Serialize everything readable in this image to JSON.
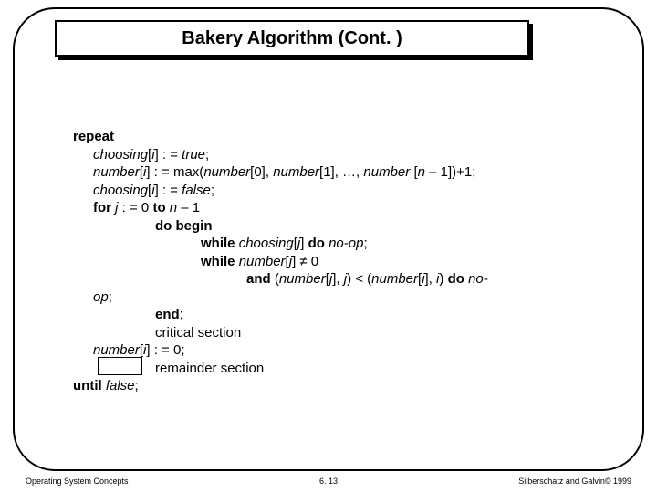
{
  "title": "Bakery Algorithm (Cont. )",
  "code": {
    "l1a": "repeat",
    "l2a": "choosing",
    "l2b": "[",
    "l2c": "i",
    "l2d": "] : = ",
    "l2e": "true",
    "l2f": ";",
    "l3a": "number",
    "l3b": "[",
    "l3c": "i",
    "l3d": "] : = max(",
    "l3e": "number",
    "l3f": "[0], ",
    "l3g": "number",
    "l3h": "[1], …, ",
    "l3i": "number ",
    "l3j": "[",
    "l3k": "n",
    "l3l": " – 1])+1;",
    "l4a": "choosing",
    "l4b": "[",
    "l4c": "i",
    "l4d": "] : = ",
    "l4e": "false",
    "l4f": ";",
    "l5a": "for ",
    "l5b": "j ",
    "l5c": ": = 0 ",
    "l5d": "to ",
    "l5e": "n",
    "l5f": " – 1",
    "l6a": "do begin",
    "l7a": "while ",
    "l7b": "choosing",
    "l7c": "[",
    "l7d": "j",
    "l7e": "] ",
    "l7f": "do ",
    "l7g": "no-op",
    "l7h": ";",
    "l8a": "while ",
    "l8b": "number",
    "l8c": "[",
    "l8d": "j",
    "l8e": "] ",
    "l8f": "≠",
    "l8g": " 0",
    "l9a": "and ",
    "l9b": "(",
    "l9c": "number",
    "l9d": "[",
    "l9e": "j",
    "l9f": "],",
    "l9g": " j",
    "l9h": ") < (",
    "l9i": "number",
    "l9j": "[",
    "l9k": "i",
    "l9l": "], ",
    "l9m": "i",
    "l9n": ") ",
    "l9o": "do ",
    "l9p": "no-",
    "l10a": "op",
    "l10b": ";",
    "l11a": "end",
    "l11b": ";",
    "l12a": "critical section",
    "l13a": "number",
    "l13b": "[",
    "l13c": "i",
    "l13d": "] : = 0;",
    "l14a": "remainder section",
    "l15a": "until ",
    "l15b": "false",
    "l15c": ";"
  },
  "footer": {
    "left": "Operating System Concepts",
    "center": "6. 13",
    "right": "Silberschatz and Galvin© 1999"
  }
}
